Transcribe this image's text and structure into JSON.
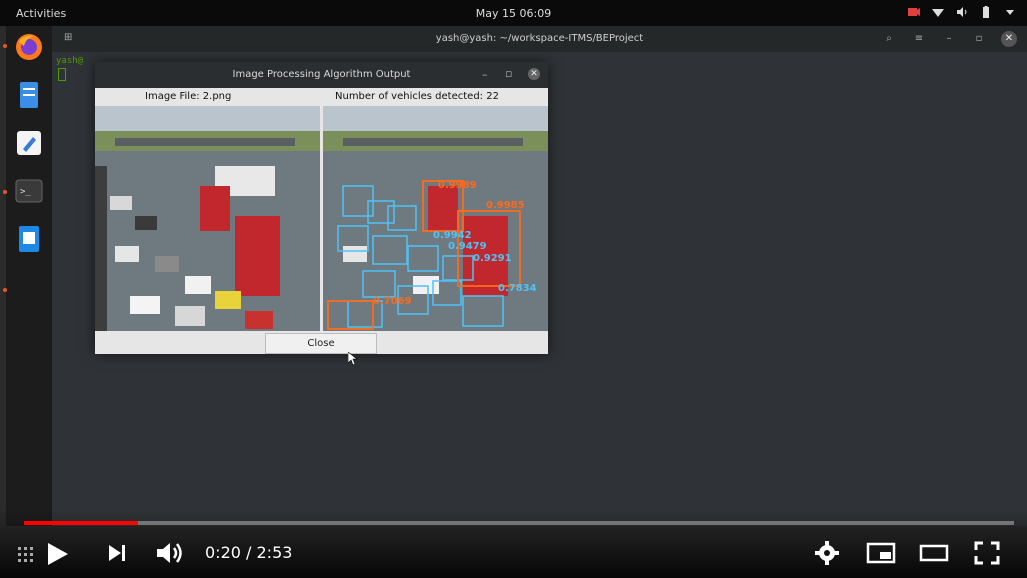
{
  "topbar": {
    "activities": "Activities",
    "clock": "May 15  06:09",
    "tray_icons": [
      "camera-icon",
      "wifi-icon",
      "volume-icon",
      "battery-icon",
      "chevron-down-icon"
    ]
  },
  "dock": {
    "items": [
      "firefox-icon",
      "files-icon",
      "text-editor-icon",
      "terminal-icon",
      "office-doc-icon"
    ]
  },
  "terminal": {
    "title": "yash@yash: ~/workspace-ITMS/BEProject",
    "prompt": "yash@"
  },
  "dialog": {
    "title": "Image Processing Algorithm Output",
    "image_file_label": "Image File: 2.png",
    "vehicles_label": "Number of vehicles detected: 22",
    "close_label": "Close",
    "detection_scores": [
      "0.9985",
      "0.9942",
      "0.9479",
      "0.9291",
      "0.7834",
      "0.9989",
      "0.7069"
    ]
  },
  "player": {
    "time": "0:20 / 2:53",
    "progress_fraction": 0.1156,
    "colors": {
      "played": "#ff0000",
      "accent_orange": "#e95420"
    }
  }
}
